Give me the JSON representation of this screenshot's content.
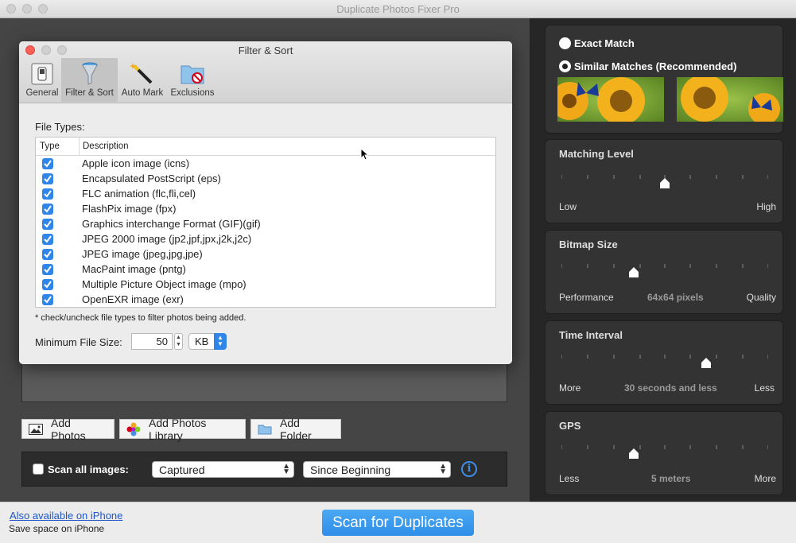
{
  "window": {
    "title": "Duplicate Photos Fixer Pro"
  },
  "dialog": {
    "title": "Filter & Sort",
    "tabs": [
      {
        "label": "General",
        "icon": "switch-icon"
      },
      {
        "label": "Filter & Sort",
        "icon": "funnel-icon",
        "active": true
      },
      {
        "label": "Auto Mark",
        "icon": "magic-wand-icon"
      },
      {
        "label": "Exclusions",
        "icon": "folder-exclude-icon"
      }
    ],
    "file_types_label": "File Types:",
    "table": {
      "col_type": "Type",
      "col_description": "Description",
      "rows": [
        {
          "checked": true,
          "description": "Apple icon image (icns)"
        },
        {
          "checked": true,
          "description": "Encapsulated PostScript (eps)"
        },
        {
          "checked": true,
          "description": "FLC animation (flc,fli,cel)"
        },
        {
          "checked": true,
          "description": "FlashPix image (fpx)"
        },
        {
          "checked": true,
          "description": "Graphics interchange Format (GIF)(gif)"
        },
        {
          "checked": true,
          "description": "JPEG 2000 image (jp2,jpf,jpx,j2k,j2c)"
        },
        {
          "checked": true,
          "description": "JPEG image (jpeg,jpg,jpe)"
        },
        {
          "checked": true,
          "description": "MacPaint image (pntg)"
        },
        {
          "checked": true,
          "description": "Multiple Picture Object image (mpo)"
        },
        {
          "checked": true,
          "description": "OpenEXR image (exr)"
        }
      ]
    },
    "note": "* check/uncheck file types to filter photos being added.",
    "min_size_label": "Minimum File Size:",
    "min_size_value": "50",
    "min_size_unit": "KB"
  },
  "add_buttons": {
    "add_photos": "Add Photos",
    "add_photos_library": "Add Photos Library",
    "add_folder": "Add Folder"
  },
  "scan_bar": {
    "scan_all_label": "Scan all images:",
    "scan_all_checked": false,
    "date_type": "Captured",
    "date_range": "Since Beginning"
  },
  "footer": {
    "iphone_link": "Also available on iPhone",
    "iphone_sub": "Save space on iPhone",
    "scan_button": "Scan for Duplicates"
  },
  "right_panel": {
    "match_mode": {
      "exact_label": "Exact Match",
      "similar_label": "Similar Matches (Recommended)",
      "selected": "similar"
    },
    "matching_level": {
      "title": "Matching Level",
      "low": "Low",
      "high": "High",
      "level": 0.5
    },
    "bitmap_size": {
      "title": "Bitmap Size",
      "low": "Performance",
      "value": "64x64 pixels",
      "high": "Quality",
      "level": 0.35
    },
    "time_interval": {
      "title": "Time Interval",
      "low": "More",
      "value": "30 seconds and less",
      "high": "Less",
      "level": 0.7
    },
    "gps": {
      "title": "GPS",
      "low": "Less",
      "value": "5 meters",
      "high": "More",
      "level": 0.35
    }
  },
  "colors": {
    "accent": "#2f86e8",
    "panel_bg": "#262626",
    "link": "#1f55c9"
  }
}
